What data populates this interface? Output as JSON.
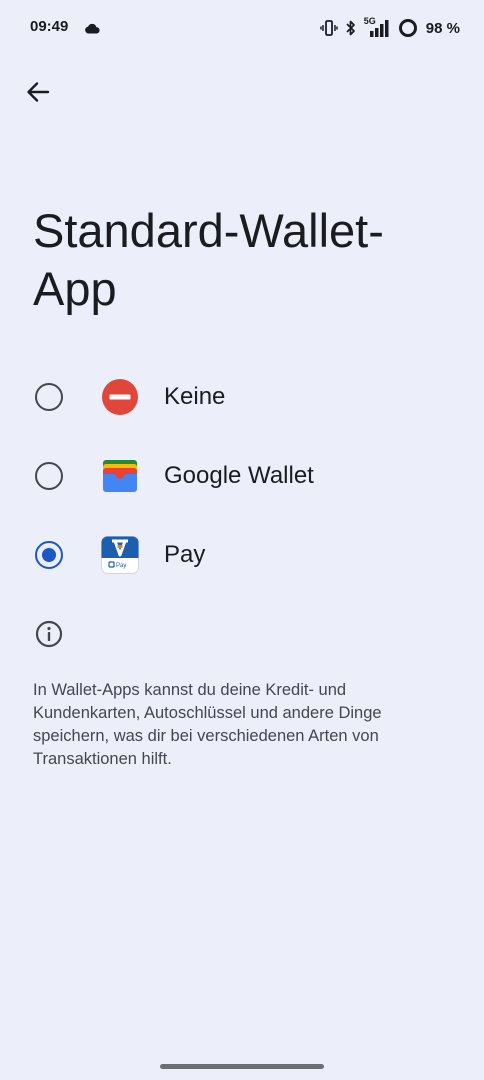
{
  "status_bar": {
    "time": "09:49",
    "network": "5G",
    "battery": "98 %"
  },
  "header": {
    "back_icon": "arrow-back-icon",
    "title": "Standard-Wallet-App"
  },
  "options": [
    {
      "label": "Keine",
      "icon": "no-entry-icon",
      "selected": false
    },
    {
      "label": "Google Wallet",
      "icon": "google-wallet-icon",
      "selected": false
    },
    {
      "label": "Pay",
      "icon": "vr-pay-icon",
      "icon_text": "Pay",
      "selected": true
    }
  ],
  "info": {
    "icon": "info-icon",
    "text": "In Wallet-Apps kannst du deine Kredit- und Kundenkarten, Autoschlüssel und andere Dinge speichern, was dir bei verschiedenen Arten von Transaktionen hilft."
  },
  "colors": {
    "background": "#eceef9",
    "accent": "#1a58c8",
    "no_entry_red": "#e0463a",
    "vr_blue": "#1c5fb0",
    "vr_orange": "#f08a00"
  }
}
